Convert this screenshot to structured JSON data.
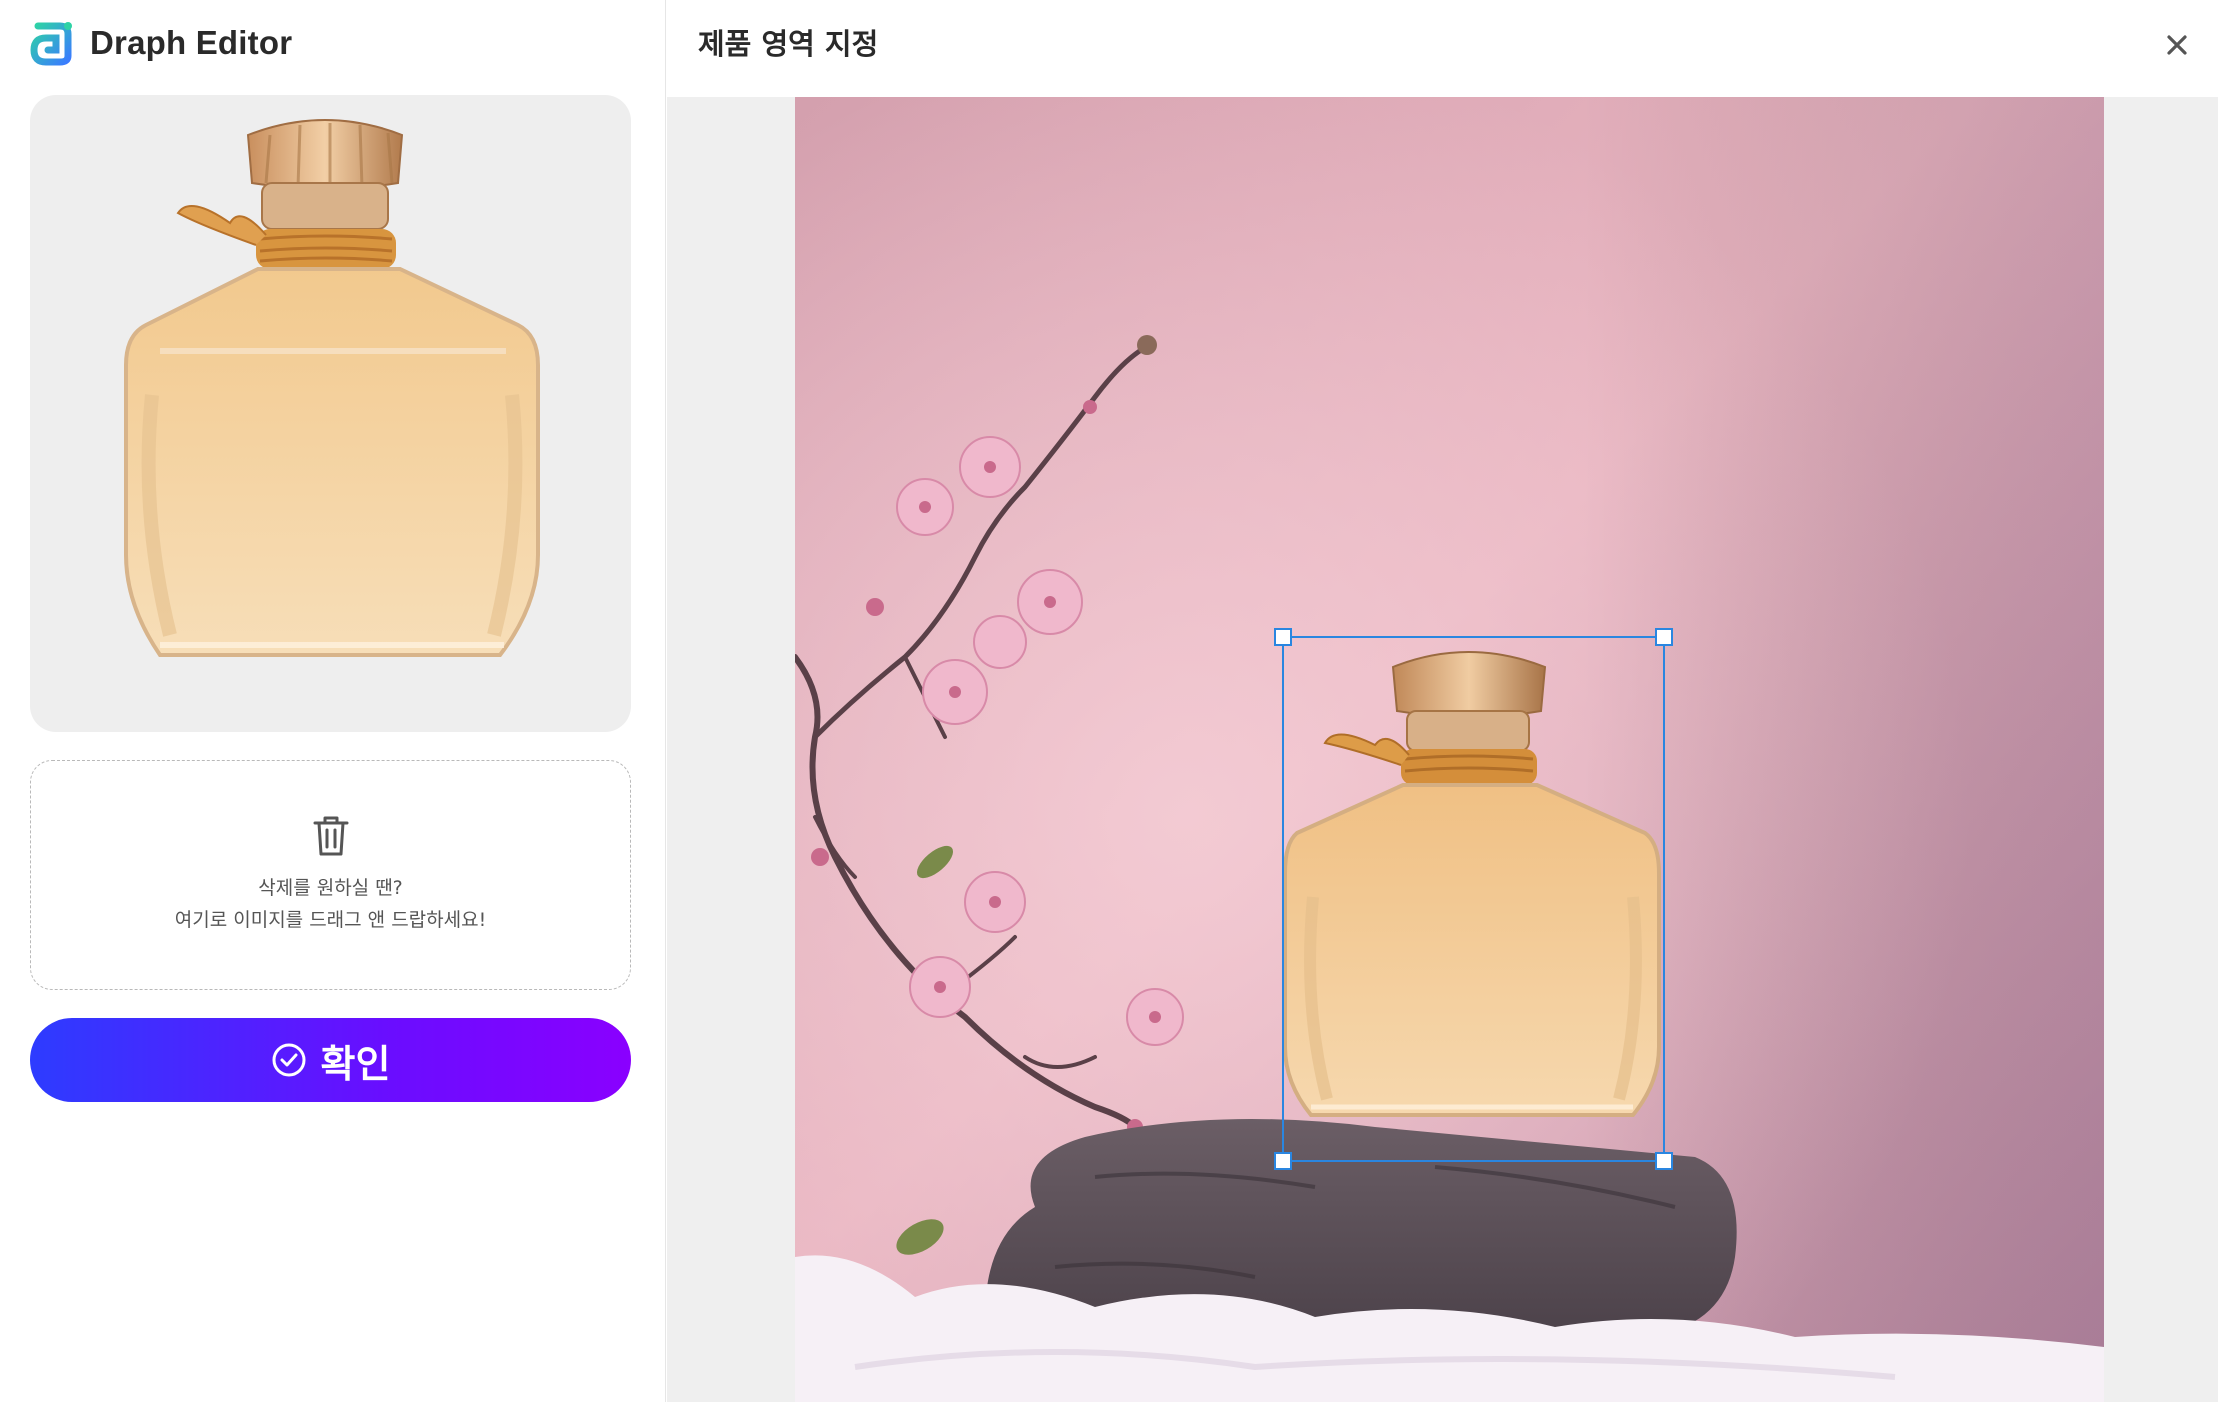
{
  "app": {
    "name": "Draph Editor"
  },
  "left_panel": {
    "dropzone": {
      "line1": "삭제를 원하실 땐?",
      "line2": "여기로 이미지를 드래그 앤 드랍하세요!"
    },
    "confirm_label": "확인"
  },
  "editor": {
    "title": "제품 영역 지정"
  },
  "colors": {
    "accent_start": "#2d3cff",
    "accent_end": "#8a00ff",
    "selection": "#2a86e0"
  },
  "icons": [
    "app-logo-icon",
    "trash-icon",
    "check-circle-icon",
    "close-icon"
  ]
}
